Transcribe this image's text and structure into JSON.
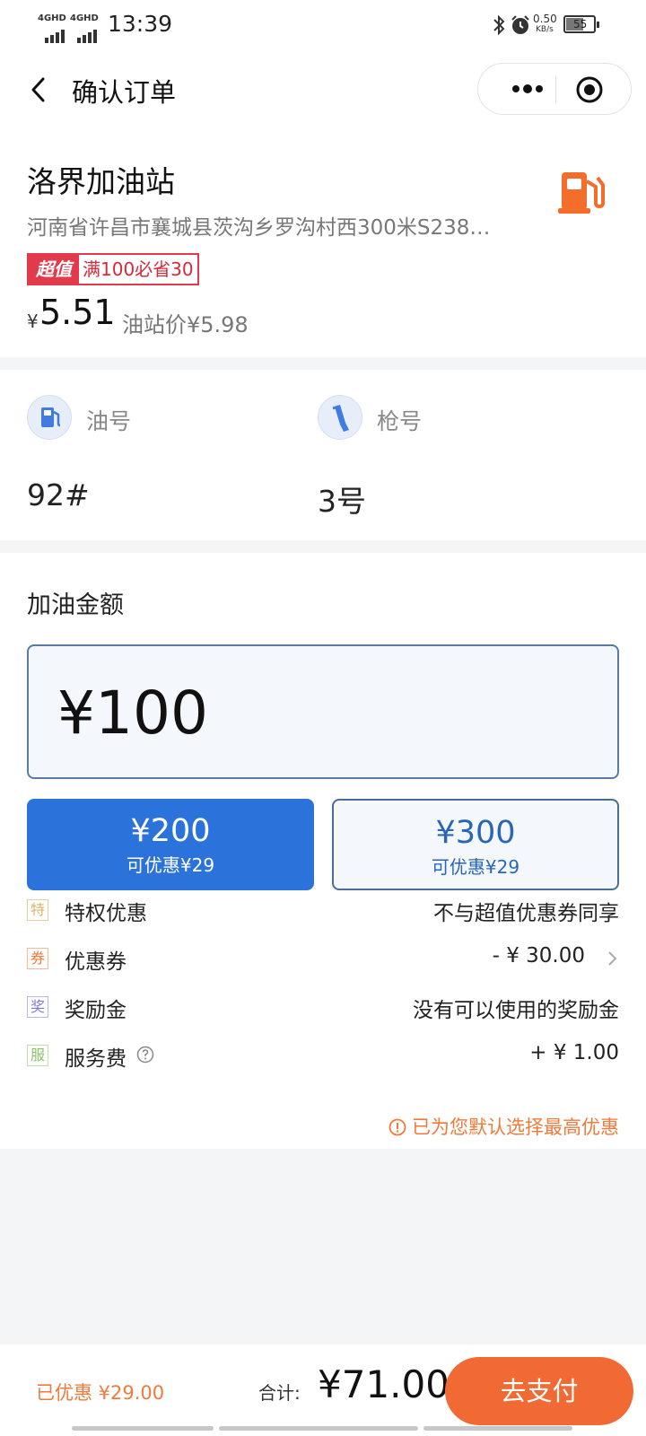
{
  "status_bar": {
    "signal1_label": "4GHD",
    "signal2_label": "4GHD",
    "time": "13:39",
    "net_speed": "0.50",
    "net_unit": "KB/s",
    "battery": "55"
  },
  "nav": {
    "title": "确认订单"
  },
  "station": {
    "name": "洛界加油站",
    "address": "河南省许昌市襄城县茨沟乡罗沟村西300米S238…",
    "promo_tag": "超值",
    "promo_text": "满100必省30",
    "price_currency": "¥",
    "price": "5.51",
    "station_price": "油站价¥5.98"
  },
  "fuel": {
    "oil_label": "油号",
    "oil_value": "92#",
    "gun_label": "枪号",
    "gun_value": "3号"
  },
  "amount": {
    "title": "加油金额",
    "input_value": "¥100",
    "options": [
      {
        "value": "¥200",
        "discount": "可优惠¥29",
        "selected": true
      },
      {
        "value": "¥300",
        "discount": "可优惠¥29",
        "selected": false
      }
    ]
  },
  "details": [
    {
      "badge": "特",
      "badge_color": "#d9b46a",
      "label": "特权优惠",
      "value": "不与超值优惠券同享"
    },
    {
      "badge": "券",
      "badge_color": "#f07a3a",
      "label": "优惠券",
      "value": "- ¥ 30.00"
    },
    {
      "badge": "奖",
      "badge_color": "#7c7ad8",
      "label": "奖励金",
      "value": "没有可以使用的奖励金"
    },
    {
      "badge": "服",
      "badge_color": "#8cc06a",
      "label": "服务费",
      "value": "+ ¥ 1.00"
    }
  ],
  "tip": "已为您默认选择最高优惠",
  "bottom": {
    "saved": "已优惠 ¥29.00",
    "total_label": "合计:",
    "total": "¥71.00",
    "pay_label": "去支付"
  },
  "colors": {
    "primary_blue": "#2b72db",
    "accent_orange": "#f26a33",
    "promo_red": "#e23a4b"
  }
}
